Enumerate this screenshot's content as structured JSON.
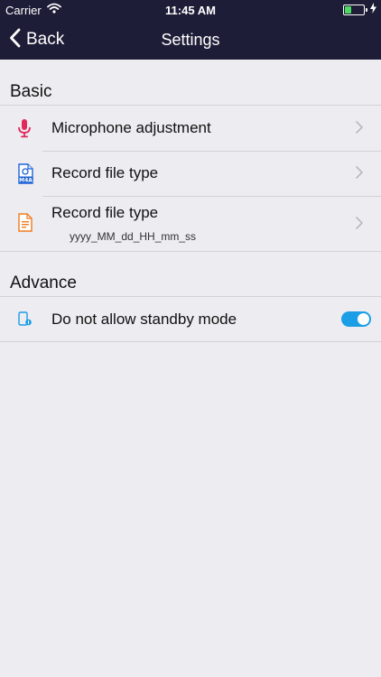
{
  "status_bar": {
    "carrier": "Carrier",
    "time": "11:45 AM",
    "battery_level": 0.35
  },
  "nav": {
    "back_label": "Back",
    "title": "Settings"
  },
  "basic": {
    "header": "Basic",
    "rows": [
      {
        "icon": "microphone-icon",
        "label": "Microphone adjustment",
        "icon_color": "#e0285b"
      },
      {
        "icon": "m4a-file-icon",
        "label": "Record file type",
        "icon_text": "M4A",
        "icon_color": "#1f63d6"
      },
      {
        "icon": "document-icon",
        "label": "Record file type",
        "value": "yyyy_MM_dd_HH_mm_ss",
        "icon_color": "#f07b1d"
      }
    ]
  },
  "advance": {
    "header": "Advance",
    "rows": [
      {
        "icon": "standby-phone-icon",
        "label": "Do not allow standby mode",
        "toggle_on": true,
        "icon_color": "#1a9ee6"
      }
    ]
  },
  "colors": {
    "nav_bg": "#1e1d38",
    "background": "#ececf1",
    "toggle_on": "#1a9ee6"
  }
}
